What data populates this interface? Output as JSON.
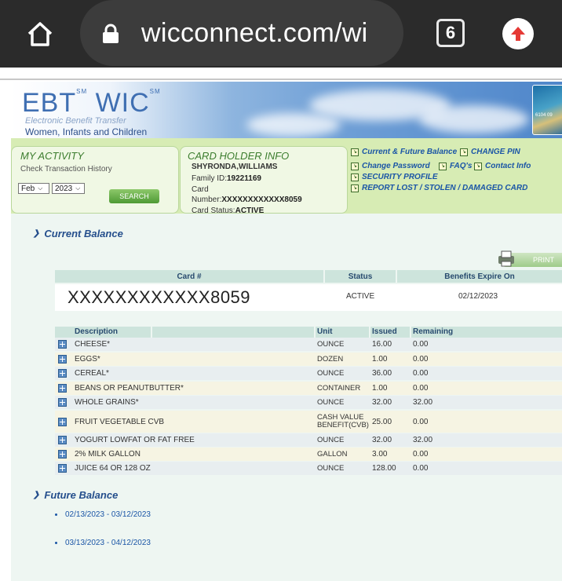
{
  "browser": {
    "url": "wicconnect.com/wi",
    "tab_count": "6"
  },
  "header": {
    "logo_text": "EBT",
    "logo_text2": "WIC",
    "sm": "SM",
    "subtitle1": "Electronic Benefit Transfer",
    "subtitle2": "Women, Infants and Children",
    "card_number_partial": "6104 09"
  },
  "my_activity": {
    "title": "MY ACTIVITY",
    "subtitle": "Check Transaction History",
    "month": "Feb",
    "year": "2023",
    "search_label": "SEARCH"
  },
  "card_holder": {
    "title": "CARD HOLDER INFO",
    "name": "SHYRONDA,WILLIAMS",
    "family_id_label": "Family ID:",
    "family_id": "19221169",
    "card_label": "Card",
    "number_label": "Number:",
    "number": "XXXXXXXXXXXX8059",
    "status_label": "Card Status:",
    "status": "ACTIVE"
  },
  "links": {
    "current_future": "Current & Future Balance",
    "change_pin": "CHANGE PIN",
    "change_password": "Change Password",
    "faqs": "FAQ's",
    "contact": "Contact Info",
    "security": "SECURITY PROFILE",
    "report": "REPORT LOST / STOLEN / DAMAGED CARD"
  },
  "current_balance": {
    "title": "Current Balance",
    "print": "PRINT",
    "headers": {
      "card": "Card #",
      "status": "Status",
      "expire": "Benefits Expire On"
    },
    "card_number": "XXXXXXXXXXXX8059",
    "status": "ACTIVE",
    "expire": "02/12/2023"
  },
  "benefits": {
    "headers": {
      "description": "Description",
      "unit": "Unit",
      "issued": "Issued",
      "remaining": "Remaining"
    },
    "rows": [
      {
        "description": "CHEESE*",
        "unit": "OUNCE",
        "issued": "16.00",
        "remaining": "0.00"
      },
      {
        "description": "EGGS*",
        "unit": "DOZEN",
        "issued": "1.00",
        "remaining": "0.00"
      },
      {
        "description": "CEREAL*",
        "unit": "OUNCE",
        "issued": "36.00",
        "remaining": "0.00"
      },
      {
        "description": "BEANS OR PEANUTBUTTER*",
        "unit": "CONTAINER",
        "issued": "1.00",
        "remaining": "0.00"
      },
      {
        "description": "WHOLE GRAINS*",
        "unit": "OUNCE",
        "issued": "32.00",
        "remaining": "32.00"
      },
      {
        "description": "FRUIT VEGETABLE CVB",
        "unit": "CASH VALUE BENEFIT(CVB)",
        "issued": "25.00",
        "remaining": "0.00"
      },
      {
        "description": "YOGURT LOWFAT OR FAT FREE",
        "unit": "OUNCE",
        "issued": "32.00",
        "remaining": "32.00"
      },
      {
        "description": "2% MILK GALLON",
        "unit": "GALLON",
        "issued": "3.00",
        "remaining": "0.00"
      },
      {
        "description": "JUICE 64 OR 128 OZ",
        "unit": "OUNCE",
        "issued": "128.00",
        "remaining": "0.00"
      }
    ]
  },
  "future_balance": {
    "title": "Future Balance",
    "periods": [
      "02/13/2023 - 03/12/2023",
      "03/13/2023 - 04/12/2023"
    ]
  },
  "colors": {
    "link_blue": "#1a55a6",
    "header_green": "#d7ecb4",
    "table_header": "#cde4dc",
    "row_odd": "#e8eef0",
    "row_even": "#f6f4e3"
  },
  "icons": [
    "home-icon",
    "lock-icon",
    "tabs-icon",
    "update-icon",
    "printer-icon",
    "expand-icon",
    "chevron-icon"
  ]
}
